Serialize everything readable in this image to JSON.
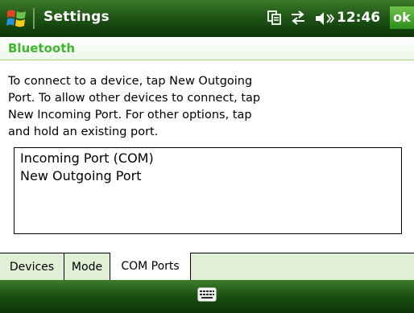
{
  "title_bar": {
    "app_title": "Settings",
    "clock": "12:46",
    "ok_label": "ok",
    "icons": [
      "windows-start-icon",
      "connectivity-icon",
      "data-sync-icon",
      "speaker-icon"
    ]
  },
  "section": {
    "title": "Bluetooth"
  },
  "instructions": {
    "line1": "To connect to a device, tap New Outgoing",
    "line2": "Port. To allow other devices to connect, tap",
    "line3": "New Incoming Port. For other options, tap",
    "line4": "and hold an existing port."
  },
  "ports": {
    "items": [
      {
        "label": "Incoming Port  (COM)"
      },
      {
        "label": "New Outgoing Port"
      }
    ]
  },
  "tabs": {
    "items": [
      {
        "label": "Devices",
        "active": false
      },
      {
        "label": "Mode",
        "active": false
      },
      {
        "label": "COM Ports",
        "active": true
      }
    ]
  },
  "bottom_bar": {
    "icons": [
      "keyboard-icon"
    ]
  },
  "colors": {
    "title_bar": "#1f5616",
    "section_title": "#3cb82c",
    "tab_strip": "#dff0d7",
    "ok_button": "#3f9c26"
  }
}
